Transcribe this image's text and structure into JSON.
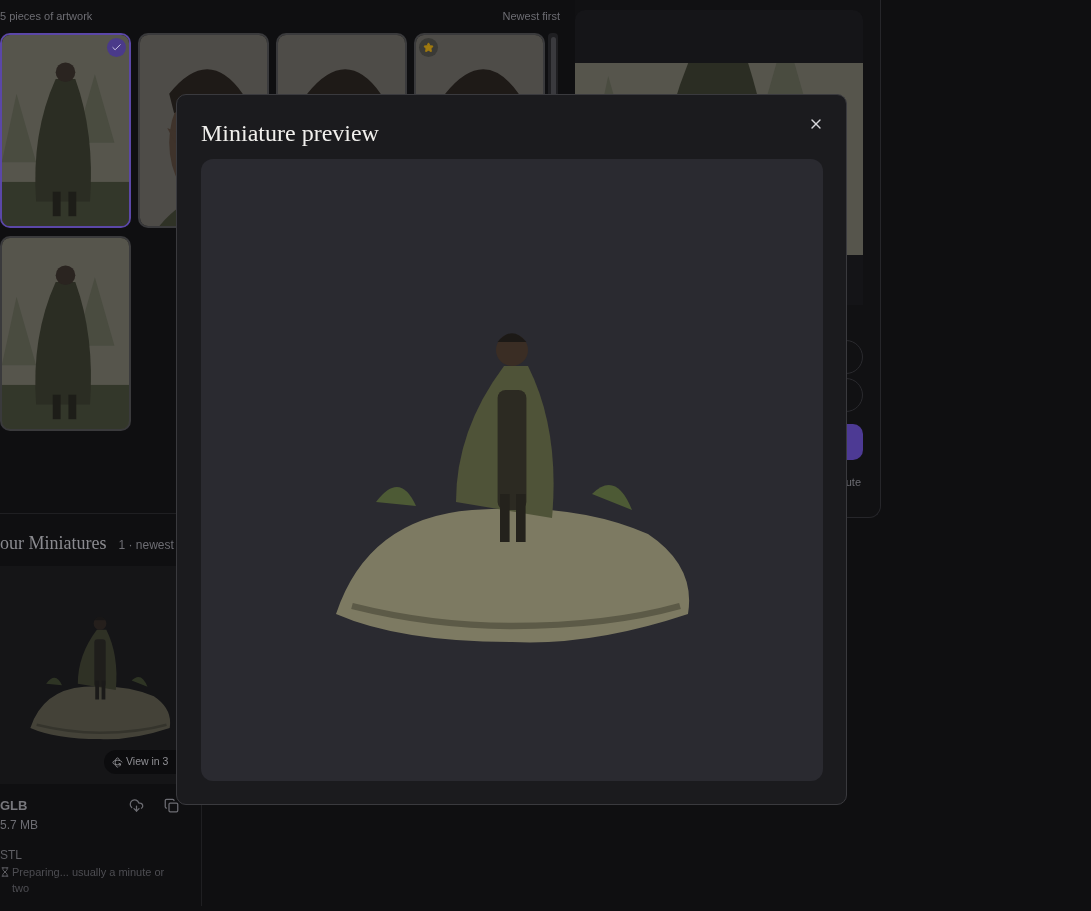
{
  "gallery": {
    "count": "5 pieces of artwork",
    "sort": "Newest first",
    "items": [
      {
        "kind": "forest",
        "selected": true,
        "favorite": false
      },
      {
        "kind": "portrait",
        "selected": false,
        "favorite": false
      },
      {
        "kind": "portrait",
        "selected": false,
        "favorite": false
      },
      {
        "kind": "portrait",
        "selected": false,
        "favorite": true
      },
      {
        "kind": "forest",
        "selected": false,
        "favorite": false
      }
    ]
  },
  "side_panel": {
    "note": "ute"
  },
  "miniatures": {
    "title": "our Miniatures",
    "meta": "1 · newest",
    "view_button": "View in 3",
    "files": [
      {
        "kind": "ready",
        "format": "GLB",
        "size": "5.7 MB"
      },
      {
        "kind": "preparing",
        "format": "STL",
        "status": "Preparing... usually a minute or two"
      }
    ]
  },
  "dialog": {
    "title": "Miniature preview"
  }
}
